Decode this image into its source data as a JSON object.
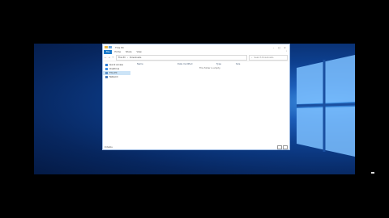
{
  "window": {
    "title": "This PC",
    "minimize_icon": "minimize-icon",
    "maximize_icon": "maximize-icon",
    "close_icon": "close-icon"
  },
  "ribbon": {
    "tabs": [
      "File",
      "Home",
      "Share",
      "View"
    ],
    "help_icon": "chevron-down-icon"
  },
  "address": {
    "back_icon": "back-arrow-icon",
    "forward_icon": "forward-arrow-icon",
    "up_icon": "up-arrow-icon",
    "path": [
      "This PC",
      "Downloads"
    ],
    "search_placeholder": "Search Downloads"
  },
  "navpane": {
    "items": [
      {
        "label": "Quick access",
        "icon": "star-icon"
      },
      {
        "label": "OneDrive",
        "icon": "cloud-icon"
      },
      {
        "label": "This PC",
        "icon": "computer-icon"
      },
      {
        "label": "Network",
        "icon": "network-icon"
      }
    ]
  },
  "content": {
    "columns": [
      "Name",
      "Date modified",
      "Type",
      "Size"
    ],
    "empty_message": "This folder is empty."
  },
  "status": {
    "item_count": "0 items"
  },
  "colors": {
    "accent": "#1979ca",
    "selection": "#cce4f7"
  }
}
